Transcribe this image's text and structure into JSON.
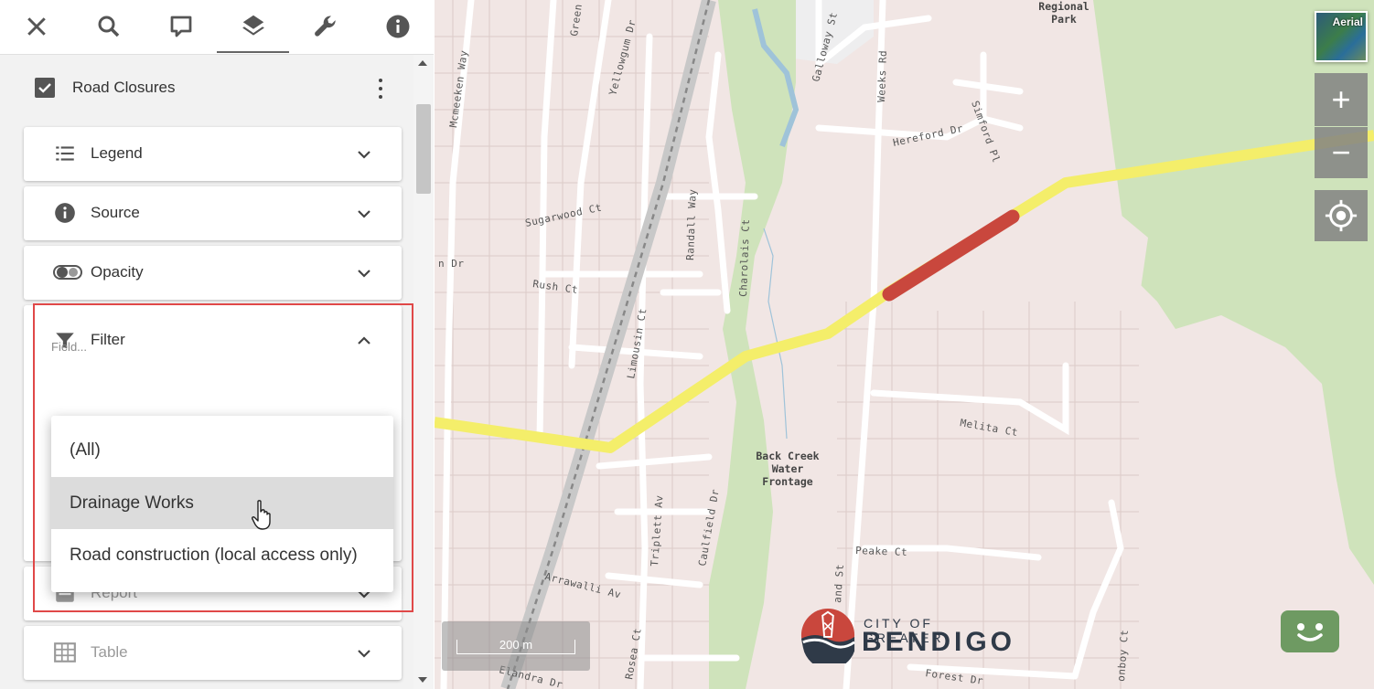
{
  "toolbar": {
    "items": [
      {
        "name": "close-icon",
        "active": false
      },
      {
        "name": "search-icon",
        "active": false
      },
      {
        "name": "comment-icon",
        "active": false
      },
      {
        "name": "layers-icon",
        "active": true
      },
      {
        "name": "wrench-icon",
        "active": false
      },
      {
        "name": "info-icon",
        "active": false
      }
    ]
  },
  "layer": {
    "name": "Road Closures",
    "checked": true
  },
  "cards": {
    "legend": {
      "label": "Legend",
      "icon": "list-icon",
      "expanded": false
    },
    "source": {
      "label": "Source",
      "icon": "info-circle-icon",
      "expanded": false
    },
    "opacity": {
      "label": "Opacity",
      "icon": "opacity-toggle-icon",
      "expanded": false
    },
    "filter": {
      "label": "Filter",
      "icon": "funnel-icon",
      "expanded": true,
      "field_placeholder": "Field..."
    },
    "report": {
      "label": "Report",
      "icon": "report-icon",
      "expanded": false
    },
    "table": {
      "label": "Table",
      "icon": "table-icon",
      "expanded": false
    }
  },
  "dropdown": {
    "options": [
      "(All)",
      "Drainage Works",
      "Road construction (local access only)"
    ],
    "hovered_index": 1
  },
  "map": {
    "labels": {
      "regional_park": [
        "Regional",
        "Park"
      ],
      "back_creek": [
        "Back Creek",
        "Water",
        "Frontage"
      ],
      "streets": [
        "Mcmeeken Way",
        "Green",
        "Yellowgum Dr",
        "Galloway St",
        "Weeks Rd",
        "Simford Pl",
        "Hereford Dr",
        "Sugarwood Ct",
        "Randall Way",
        "Charolais Ct",
        "Rush Ct",
        "Limousin Ct",
        "Melita Ct",
        "Peake Ct",
        "Triplett Av",
        "Caulfield Dr",
        "Arrawalli Av",
        "Elandra Dr",
        "Rosea Ct",
        "Forest Dr",
        "onboy Ct",
        "and St",
        "n Dr"
      ]
    },
    "aerial_label": "Aerial",
    "zoom_in": "+",
    "zoom_out": "−",
    "scale": "200 m",
    "logo": {
      "top": "CITY OF GREATER",
      "main": "BENDIGO"
    },
    "colors": {
      "closure_route": "#f4ee6a",
      "closure_segment": "#c9473d",
      "parkland": "#cde2b8",
      "urban": "#f1e6e4"
    }
  }
}
